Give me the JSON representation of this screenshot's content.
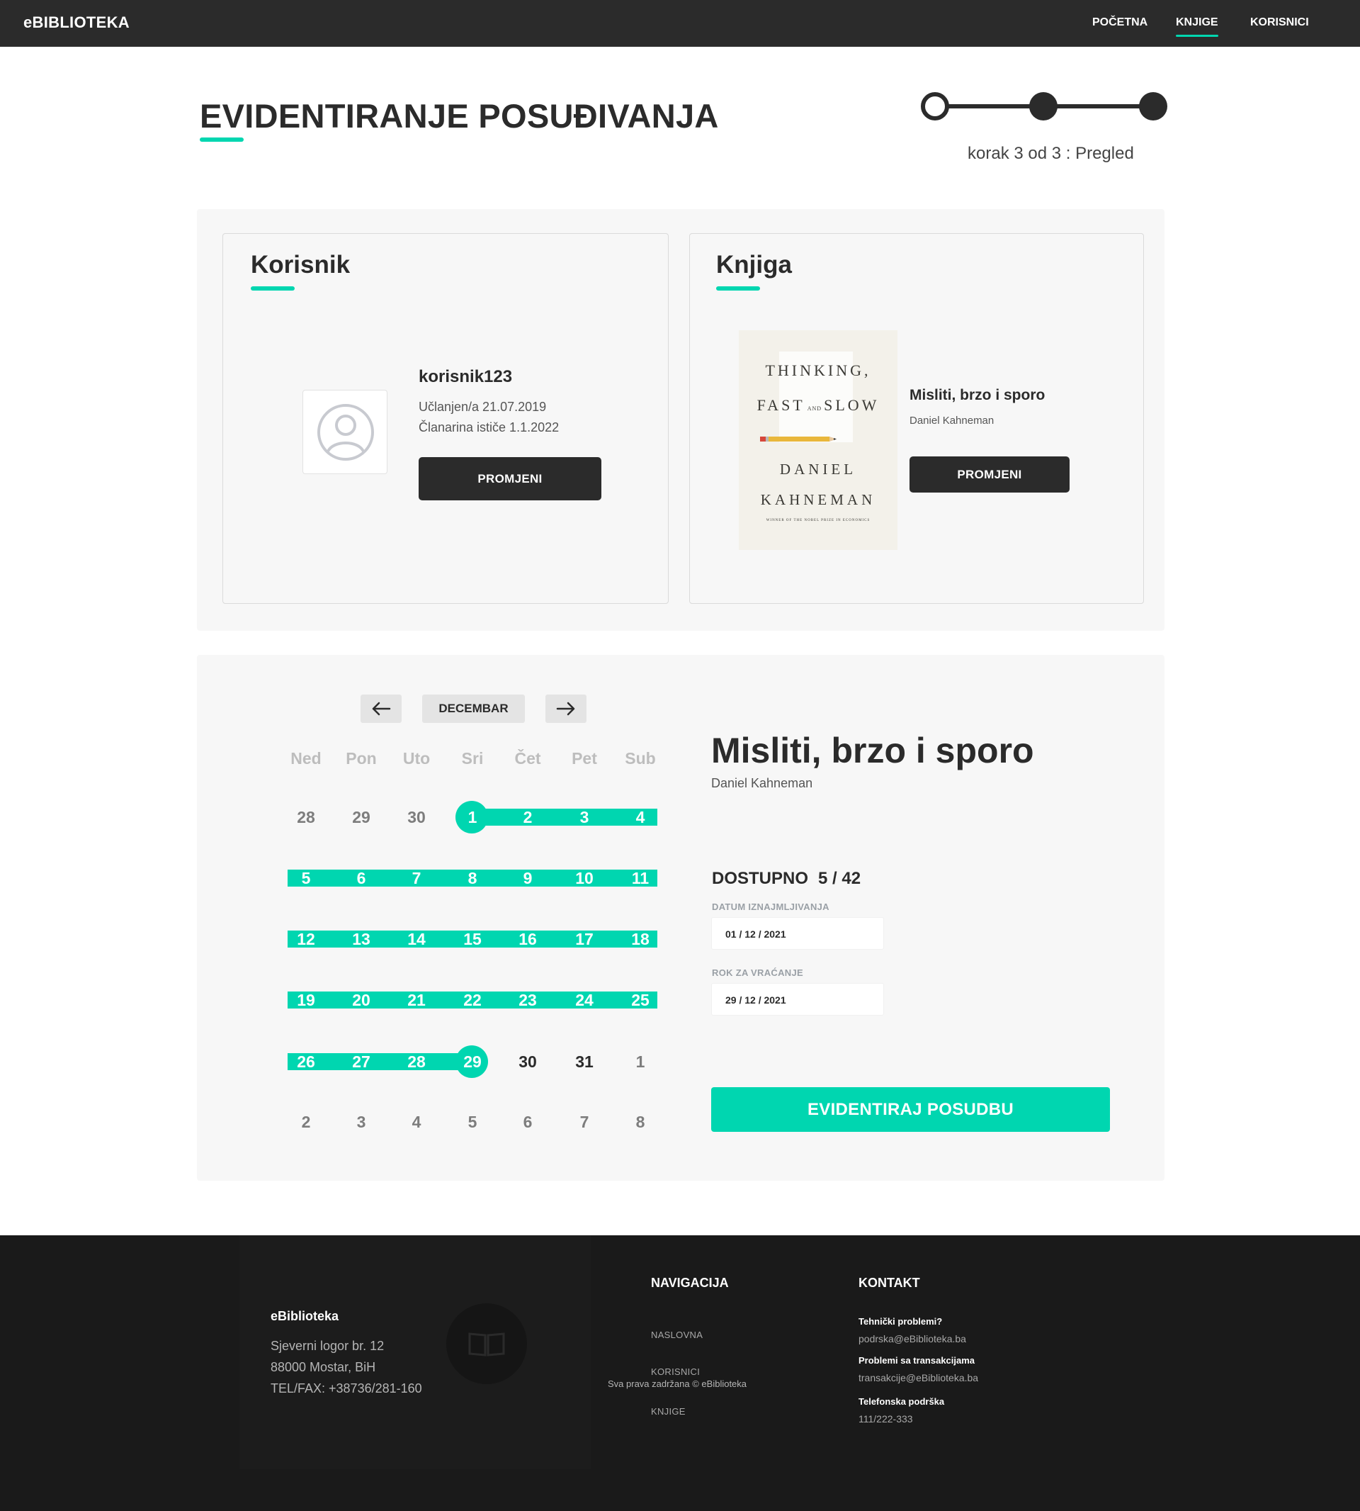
{
  "header": {
    "brand": "eBIBLIOTEKA",
    "nav": [
      {
        "label": "POČETNA",
        "active": false
      },
      {
        "label": "KNJIGE",
        "active": true
      },
      {
        "label": "KORISNICI",
        "active": false
      }
    ]
  },
  "page": {
    "title": "EVIDENTIRANJE POSUĐIVANJA",
    "step": {
      "current": 3,
      "total": 3,
      "label": "korak 3 od 3 : Pregled"
    }
  },
  "user_card": {
    "title": "Korisnik",
    "username": "korisnik123",
    "joined": "Učlanjen/a 21.07.2019",
    "membership": "Članarina ističe 1.1.2022",
    "change_button": "PROMJENI",
    "avatar_icon": "user-avatar-icon"
  },
  "book_card": {
    "title": "Knjiga",
    "book_title": "Misliti, brzo i sporo",
    "book_author": "Daniel Kahneman",
    "change_button": "PROMJENI",
    "cover": {
      "line1": "THINKING,",
      "line2a": "FAST",
      "line2and": "AND",
      "line2b": "SLOW",
      "author1": "DANIEL",
      "author2": "KAHNEMAN",
      "tagline": "WINNER OF THE NOBEL PRIZE IN ECONOMICS"
    }
  },
  "calendar": {
    "prev_icon": "arrow-left-icon",
    "next_icon": "arrow-right-icon",
    "month": "DECEMBAR",
    "weekdays": [
      "Ned",
      "Pon",
      "Uto",
      "Sri",
      "Čet",
      "Pet",
      "Sub"
    ],
    "weeks": [
      [
        {
          "d": "28",
          "s": "muted"
        },
        {
          "d": "29",
          "s": "muted"
        },
        {
          "d": "30",
          "s": "muted"
        },
        {
          "d": "1",
          "s": "sel"
        },
        {
          "d": "2",
          "s": "sel"
        },
        {
          "d": "3",
          "s": "sel"
        },
        {
          "d": "4",
          "s": "sel"
        }
      ],
      [
        {
          "d": "5",
          "s": "sel"
        },
        {
          "d": "6",
          "s": "sel"
        },
        {
          "d": "7",
          "s": "sel"
        },
        {
          "d": "8",
          "s": "sel"
        },
        {
          "d": "9",
          "s": "sel"
        },
        {
          "d": "10",
          "s": "sel"
        },
        {
          "d": "11",
          "s": "sel"
        }
      ],
      [
        {
          "d": "12",
          "s": "sel"
        },
        {
          "d": "13",
          "s": "sel"
        },
        {
          "d": "14",
          "s": "sel"
        },
        {
          "d": "15",
          "s": "sel"
        },
        {
          "d": "16",
          "s": "sel"
        },
        {
          "d": "17",
          "s": "sel"
        },
        {
          "d": "18",
          "s": "sel"
        }
      ],
      [
        {
          "d": "19",
          "s": "sel"
        },
        {
          "d": "20",
          "s": "sel"
        },
        {
          "d": "21",
          "s": "sel"
        },
        {
          "d": "22",
          "s": "sel"
        },
        {
          "d": "23",
          "s": "sel"
        },
        {
          "d": "24",
          "s": "sel"
        },
        {
          "d": "25",
          "s": "sel"
        }
      ],
      [
        {
          "d": "26",
          "s": "sel"
        },
        {
          "d": "27",
          "s": "sel"
        },
        {
          "d": "28",
          "s": "sel"
        },
        {
          "d": "29",
          "s": "sel"
        },
        {
          "d": "30",
          "s": "cur"
        },
        {
          "d": "31",
          "s": "cur"
        },
        {
          "d": "1",
          "s": "muted"
        }
      ],
      [
        {
          "d": "2",
          "s": "muted"
        },
        {
          "d": "3",
          "s": "muted"
        },
        {
          "d": "4",
          "s": "muted"
        },
        {
          "d": "5",
          "s": "muted"
        },
        {
          "d": "6",
          "s": "muted"
        },
        {
          "d": "7",
          "s": "muted"
        },
        {
          "d": "8",
          "s": "muted"
        }
      ]
    ],
    "range_start": "1",
    "range_end": "29"
  },
  "summary": {
    "book_title": "Misliti, brzo i sporo",
    "book_author": "Daniel Kahneman",
    "available_label": "DOSTUPNO",
    "available_value": "5 / 42",
    "rent_date_label": "DATUM IZNAJMLJIVANJA",
    "rent_date": "01 / 12 / 2021",
    "return_date_label": "ROK ZA VRAĆANJE",
    "return_date": "29 / 12 / 2021",
    "submit": "EVIDENTIRAJ POSUDBU"
  },
  "footer": {
    "brand": "eBiblioteka",
    "address1": "Sjeverni logor br. 12",
    "address2": "88000 Mostar, BiH",
    "phone": "TEL/FAX: +38736/281-160",
    "logo_icon": "book-icon",
    "nav_title": "NAVIGACIJA",
    "nav_links": [
      "NASLOVNA",
      "KORISNICI",
      "KNJIGE"
    ],
    "copyright": "Sva prava zadržana © eBiblioteka",
    "contact_title": "KONTAKT",
    "contact": [
      {
        "label": "Tehnički problemi?",
        "value": "podrska@eBiblioteka.ba"
      },
      {
        "label": "Problemi sa transakcijama",
        "value": "transakcije@eBiblioteka.ba"
      },
      {
        "label": "Telefonska podrška",
        "value": "111/222-333"
      }
    ]
  },
  "colors": {
    "accent": "#00d6b0",
    "dark": "#2b2b2b",
    "panel": "#f7f7f7",
    "footer": "#1a1a1a"
  }
}
